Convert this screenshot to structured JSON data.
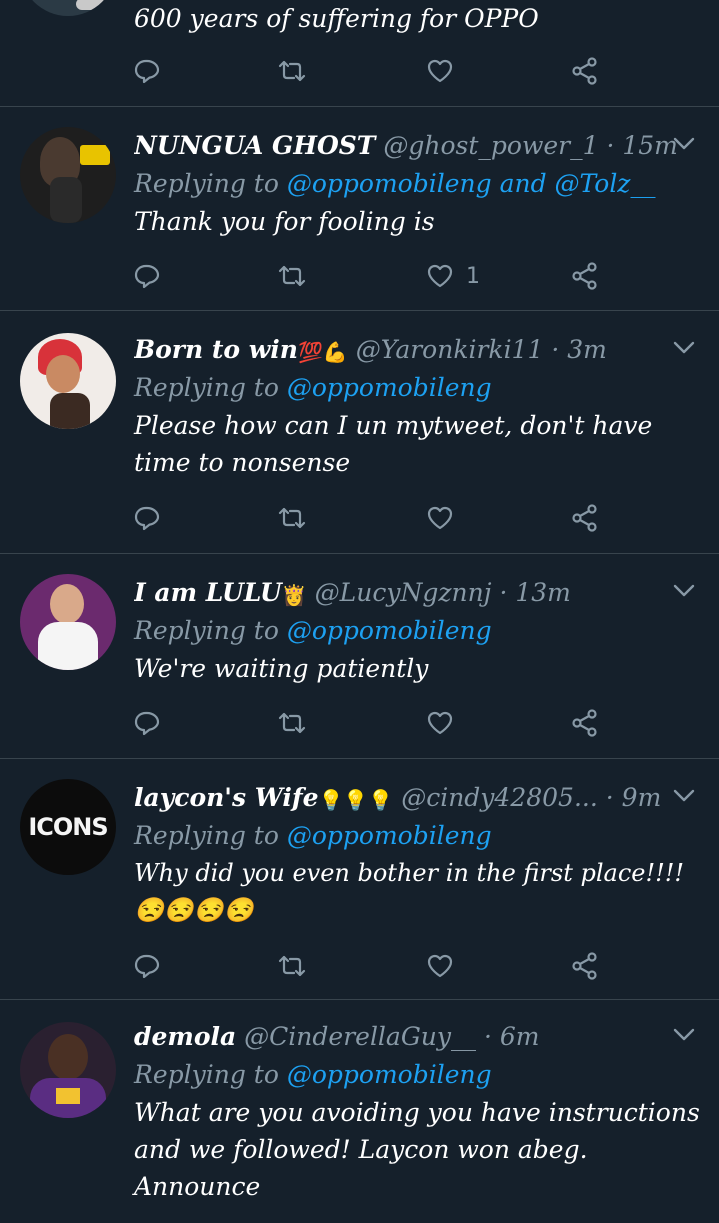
{
  "tweets": [
    {
      "name": "",
      "handle": "",
      "time": "",
      "replying_prefix": "",
      "mentions": [],
      "text": "600 years of suffering for OPPO",
      "likes": ""
    },
    {
      "name": "NUNGUA GHOST",
      "name_emoji": "",
      "handle": "@ghost_power_1",
      "time": "15m",
      "replying_prefix": "Replying to",
      "mention1": "@oppomobileng",
      "joiner": "and",
      "mention2": "@Tolz__",
      "text": "Thank you for fooling is",
      "likes": "1"
    },
    {
      "name": "Born to win",
      "name_emoji": "💯💪",
      "handle": "@Yaronkirki11",
      "time": "3m",
      "replying_prefix": "Replying to",
      "mention1": "@oppomobileng",
      "text_l1": "Please how can I un mytweet, don't have",
      "text_l2": "time to nonsense",
      "likes": ""
    },
    {
      "name": "I am LULU",
      "name_emoji": "👸",
      "handle": "@LucyNgznnj",
      "time": "13m",
      "replying_prefix": "Replying to",
      "mention1": "@oppomobileng",
      "text": "We're waiting patiently",
      "likes": ""
    },
    {
      "name": "laycon's Wife",
      "name_emoji": "💡💡💡",
      "handle": "@cindy42805...",
      "time": "9m",
      "replying_prefix": "Replying to",
      "mention1": "@oppomobileng",
      "text_l1": "Why did you even bother in the first place!!!!",
      "text_emoji": "😒😒😒😒",
      "avatar_text": "ICONS",
      "likes": ""
    },
    {
      "name": "demola",
      "handle": "@CinderellaGuy__",
      "time": "6m",
      "replying_prefix": "Replying to",
      "mention1": "@oppomobileng",
      "text_l1": "What are you avoiding you have instructions",
      "text_l2": "and we followed! Laycon won abeg.",
      "text_l3": "Announce",
      "likes": ""
    }
  ],
  "sep": "·",
  "icons": {
    "reply": "reply-icon",
    "retweet": "retweet-icon",
    "like": "heart-icon",
    "share": "share-icon",
    "caret": "chevron-down-icon"
  },
  "colors": {
    "bg": "#15202b",
    "muted": "#8899a6",
    "link": "#1da1f2",
    "divider": "#38444d"
  }
}
